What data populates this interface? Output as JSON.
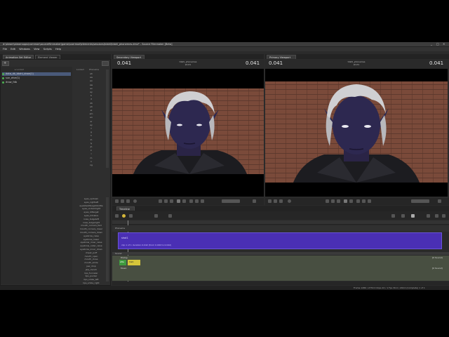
{
  "window": {
    "title": "d:\\steam\\steamapps\\common\\sourcefilmmaker\\game\\usermod\\elements\\sessions\\tdahl\\tdahl_phonemes.dmx* - Source Filmmaker [Beta]",
    "controls": [
      "_",
      "□",
      "×"
    ]
  },
  "menu": [
    "File",
    "Edit",
    "Windows",
    "View",
    "Scripts",
    "Help"
  ],
  "left_panel": {
    "tabs": [
      "Animation Set Editor",
      "Element Viewer"
    ],
    "animation_sets": [
      "dota_dk_tdahl_drow(1)",
      "sun_elve(1)",
      "drow_fdb"
    ],
    "column_headers": [
      "Locked",
      "Phoneme"
    ],
    "phonemes": [
      "ah",
      "aa",
      "ao",
      "aw",
      "ax",
      "ay",
      "b",
      "d",
      "dh",
      "eh",
      "el",
      "em",
      "en",
      "er",
      "ey",
      "f",
      "g",
      "h",
      "ih",
      "iy",
      "jh",
      "k",
      "l",
      "m",
      "n",
      "ng"
    ],
    "controls": [
      "eyes_updown",
      "eyes_rightleft",
      "eyelidsLRtarget/bottle",
      "eyes_undermight",
      "eyes_lidtarget",
      "eyes_lidvalue",
      "nose_bulgeleft",
      "nose_bulgeright",
      "mouth_corners_fwd",
      "mouth_corners_lower",
      "mouth_corners_down",
      "eyebrow_raise",
      "eyebrow_lower",
      "eyebrow_inner_raise",
      "eyebrow_outer_raise",
      "eyebrow_inner_down",
      "cheek_puff",
      "mouth_open",
      "mouth_close",
      "mouth_smile",
      "jaw_drop",
      "jaw_clench",
      "lips_funneler",
      "lips_pucker",
      "lips_smile_left",
      "lips_smile_right"
    ]
  },
  "viewports": [
    {
      "tab": "Secondary Viewport",
      "frame": "0.041",
      "frame_right": "0.041",
      "name": "tdahl_phonemes",
      "sub": "shot1"
    },
    {
      "tab": "Primary Viewport",
      "frame": "0.041",
      "frame_right": "0.041",
      "name": "tdahl_phonemes",
      "sub": "shot1"
    }
  ],
  "timeline": {
    "tab": "Timeline",
    "track_label": "Phoneme",
    "clip_name": "shot1",
    "clip_detail": "clip 1 of 1 duration 0.042 (from 0.000 to 0.042)",
    "group_label": "Sound",
    "sub_label": "Dialog",
    "channel_label": "Music",
    "clip_a": "wfile",
    "clip_b": "tdahl",
    "sound_label": "[0 Sound]"
  },
  "status": {
    "left": "",
    "right": "Frame  1280 / 2730  0 Clips          22 / 1 Fps  30.0 / 240.0 (Complete)   1 of 1"
  },
  "colors": {
    "clip_purple": "#4a2fb4",
    "green": "#4caf50",
    "selection": "#4a5a7a"
  }
}
